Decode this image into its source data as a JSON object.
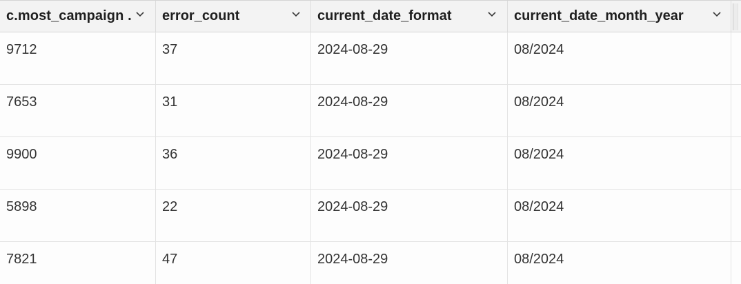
{
  "table": {
    "columns": [
      {
        "label": "c.most_campaign ."
      },
      {
        "label": "error_count"
      },
      {
        "label": "current_date_format"
      },
      {
        "label": "current_date_month_year"
      }
    ],
    "rows": [
      [
        "9712",
        "37",
        "2024-08-29",
        "08/2024"
      ],
      [
        "7653",
        "31",
        "2024-08-29",
        "08/2024"
      ],
      [
        "9900",
        "36",
        "2024-08-29",
        "08/2024"
      ],
      [
        "5898",
        "22",
        "2024-08-29",
        "08/2024"
      ],
      [
        "7821",
        "47",
        "2024-08-29",
        "08/2024"
      ]
    ]
  },
  "icons": {
    "sort_menu": "chevron-down-icon",
    "column_resize": "column-gripper-icon"
  }
}
